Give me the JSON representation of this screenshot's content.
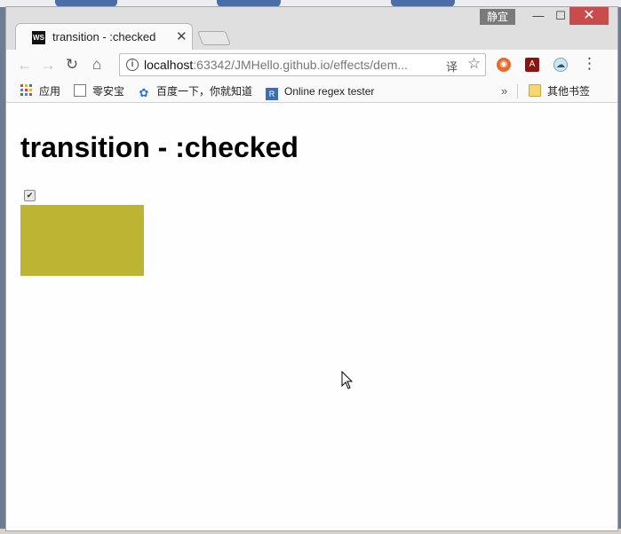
{
  "window": {
    "user_badge": "静宜",
    "min_glyph": "—",
    "max_glyph": "☐",
    "close_glyph": "✕"
  },
  "tab": {
    "favicon_label": "WS",
    "favicon_icon": "webstorm-icon",
    "title": "transition - :checked",
    "close_glyph": "✕"
  },
  "toolbar": {
    "back_glyph": "←",
    "forward_glyph": "→",
    "reload_glyph": "↻",
    "home_glyph": "⌂",
    "url_host": "localhost",
    "url_rest": ":63342/JMHello.github.io/effects/dem...",
    "translate_glyph": "译",
    "star_glyph": "☆",
    "menu_glyph": "⋮"
  },
  "bookmarks": [
    {
      "label": "应用",
      "icon": "apps-grid-icon"
    },
    {
      "label": "零安宝",
      "icon": "bookmark-icon"
    },
    {
      "label": "百度一下，你就知道",
      "icon": "baidu-paw-icon"
    },
    {
      "label": "Online regex tester",
      "icon": "regex-icon"
    }
  ],
  "bookmarks_more": "»",
  "other_bookmarks": "其他书签",
  "page": {
    "heading": "transition - :checked",
    "checkbox_checked": true,
    "checkbox_glyph": "✔",
    "box_color": "#bdb433"
  },
  "colors": {
    "close_red": "#c94c4c",
    "box": "#bdb433"
  }
}
